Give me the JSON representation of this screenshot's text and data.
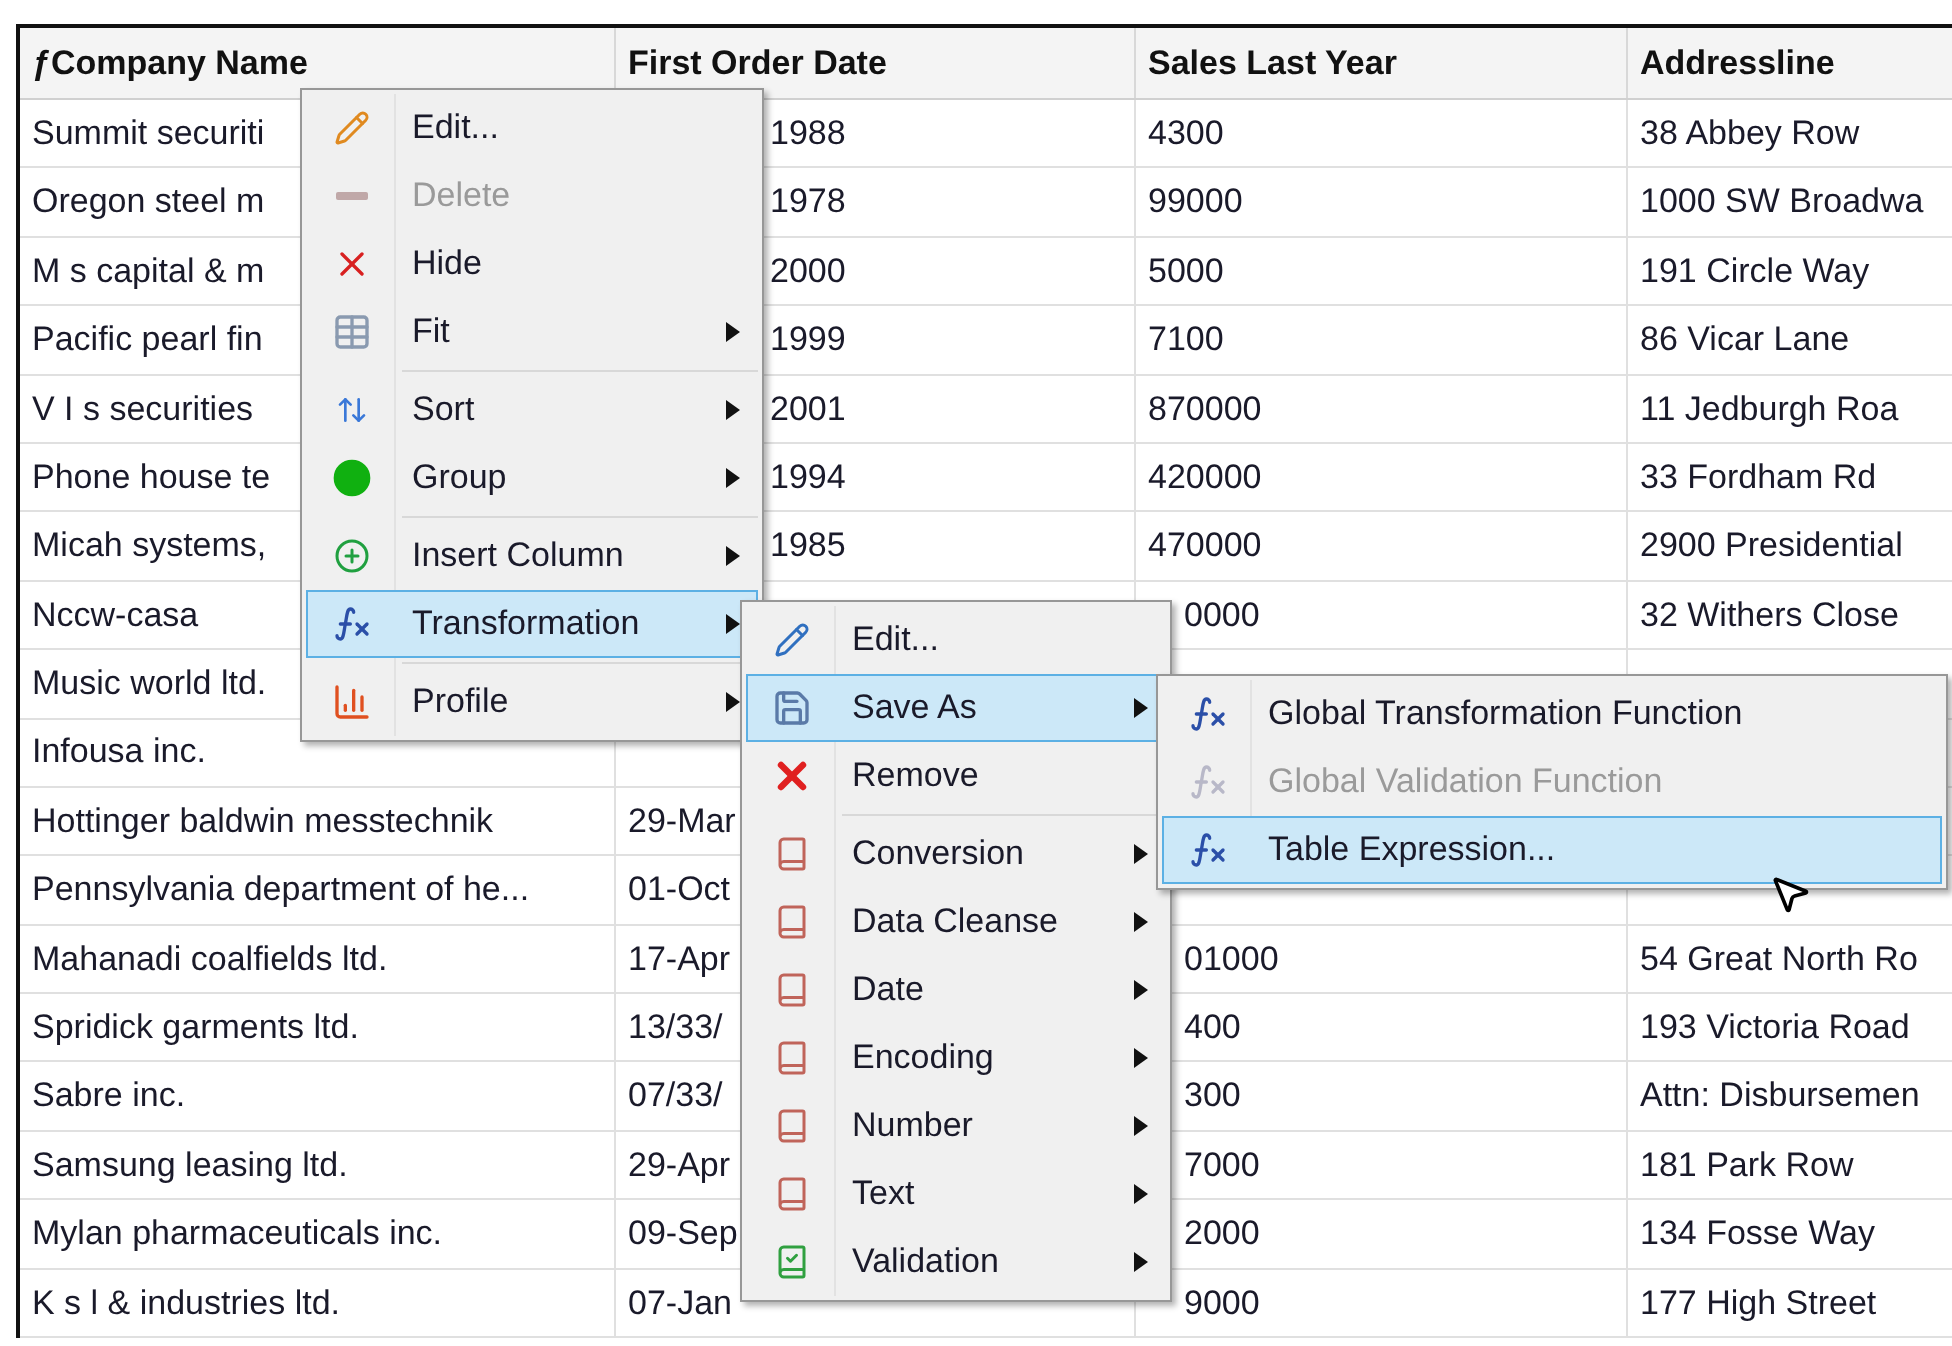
{
  "table": {
    "columns": [
      "ƒCompany Name",
      "First Order Date",
      "Sales Last Year",
      "Addressline"
    ],
    "rows": [
      [
        {
          "text": "Summit securiti"
        },
        {
          "text": "1988",
          "clipped": true
        },
        {
          "text": "4300"
        },
        {
          "text": "38 Abbey Row"
        }
      ],
      [
        {
          "text": "Oregon steel m"
        },
        {
          "text": "1978",
          "clipped": true
        },
        {
          "text": "99000"
        },
        {
          "text": "1000 SW Broadwa"
        }
      ],
      [
        {
          "text": "M s capital & m"
        },
        {
          "text": "2000",
          "clipped": true
        },
        {
          "text": "5000"
        },
        {
          "text": "191 Circle Way"
        }
      ],
      [
        {
          "text": "Pacific pearl fin"
        },
        {
          "text": "1999",
          "clipped": true
        },
        {
          "text": "7100"
        },
        {
          "text": "86 Vicar Lane"
        }
      ],
      [
        {
          "text": "V I s securities"
        },
        {
          "text": "2001",
          "clipped": true
        },
        {
          "text": "870000"
        },
        {
          "text": "11 Jedburgh Roa"
        }
      ],
      [
        {
          "text": "Phone house te"
        },
        {
          "text": "1994",
          "clipped": true
        },
        {
          "text": "420000"
        },
        {
          "text": "33 Fordham Rd"
        }
      ],
      [
        {
          "text": "Micah systems,"
        },
        {
          "text": "1985",
          "clipped": true
        },
        {
          "text": "470000"
        },
        {
          "text": "2900 Presidential"
        }
      ],
      [
        {
          "text": "Nccw-casa"
        },
        null,
        {
          "text": "0000",
          "clipped": true
        },
        {
          "text": "32 Withers Close"
        }
      ],
      [
        {
          "text": "Music world ltd."
        },
        null,
        null,
        null
      ],
      [
        {
          "text": "Infousa inc."
        },
        null,
        null,
        null
      ],
      [
        {
          "text": "Hottinger baldwin messtechnik"
        },
        {
          "text": "29-Mar"
        },
        null,
        null
      ],
      [
        {
          "text": "Pennsylvania department of he..."
        },
        {
          "text": "01-Oct"
        },
        null,
        null
      ],
      [
        {
          "text": "Mahanadi coalfields ltd."
        },
        {
          "text": "17-Apr"
        },
        {
          "text": "01000",
          "clipped": true
        },
        {
          "text": "54 Great North Ro"
        }
      ],
      [
        {
          "text": "Spridick garments ltd."
        },
        {
          "text": "13/33/"
        },
        {
          "text": "400",
          "clipped": true
        },
        {
          "text": "193 Victoria Road"
        }
      ],
      [
        {
          "text": "Sabre inc."
        },
        {
          "text": "07/33/"
        },
        {
          "text": "300",
          "clipped": true
        },
        {
          "text": "Attn: Disbursemen"
        }
      ],
      [
        {
          "text": "Samsung leasing ltd."
        },
        {
          "text": "29-Apr"
        },
        {
          "text": "7000",
          "clipped": true
        },
        {
          "text": "181 Park Row"
        }
      ],
      [
        {
          "text": "Mylan pharmaceuticals inc."
        },
        {
          "text": "09-Sep"
        },
        {
          "text": "2000",
          "clipped": true
        },
        {
          "text": "134 Fosse Way"
        }
      ],
      [
        {
          "text": "K s l & industries ltd."
        },
        {
          "text": "07-Jan"
        },
        {
          "text": "9000",
          "clipped": true
        },
        {
          "text": "177 High Street"
        }
      ]
    ]
  },
  "context_menu": {
    "items": [
      {
        "label": "Edit...",
        "submenu": false,
        "disabled": false,
        "selected": false
      },
      {
        "label": "Delete",
        "submenu": false,
        "disabled": true,
        "selected": false
      },
      {
        "label": "Hide",
        "submenu": false,
        "disabled": false,
        "selected": false
      },
      {
        "label": "Fit",
        "submenu": true,
        "disabled": false,
        "selected": false
      },
      {
        "label": "Sort",
        "submenu": true,
        "disabled": false,
        "selected": false,
        "separator_before": true
      },
      {
        "label": "Group",
        "submenu": true,
        "disabled": false,
        "selected": false
      },
      {
        "label": "Insert Column",
        "submenu": true,
        "disabled": false,
        "selected": false,
        "separator_before": true
      },
      {
        "label": "Transformation",
        "submenu": true,
        "disabled": false,
        "selected": true
      },
      {
        "label": "Profile",
        "submenu": true,
        "disabled": false,
        "selected": false,
        "separator_before": true
      }
    ]
  },
  "transformation_submenu": {
    "items": [
      {
        "label": "Edit...",
        "submenu": false,
        "disabled": false,
        "selected": false
      },
      {
        "label": "Save As",
        "submenu": true,
        "disabled": false,
        "selected": true
      },
      {
        "label": "Remove",
        "submenu": false,
        "disabled": false,
        "selected": false
      },
      {
        "label": "Conversion",
        "submenu": true,
        "disabled": false,
        "selected": false,
        "separator_before": true
      },
      {
        "label": "Data Cleanse",
        "submenu": true,
        "disabled": false,
        "selected": false
      },
      {
        "label": "Date",
        "submenu": true,
        "disabled": false,
        "selected": false
      },
      {
        "label": "Encoding",
        "submenu": true,
        "disabled": false,
        "selected": false
      },
      {
        "label": "Number",
        "submenu": true,
        "disabled": false,
        "selected": false
      },
      {
        "label": "Text",
        "submenu": true,
        "disabled": false,
        "selected": false
      },
      {
        "label": "Validation",
        "submenu": true,
        "disabled": false,
        "selected": false
      }
    ]
  },
  "save_as_submenu": {
    "items": [
      {
        "label": "Global Transformation Function",
        "submenu": false,
        "disabled": false,
        "selected": false
      },
      {
        "label": "Global Validation Function",
        "submenu": false,
        "disabled": true,
        "selected": false
      },
      {
        "label": "Table Expression...",
        "submenu": false,
        "disabled": false,
        "selected": true
      }
    ]
  }
}
